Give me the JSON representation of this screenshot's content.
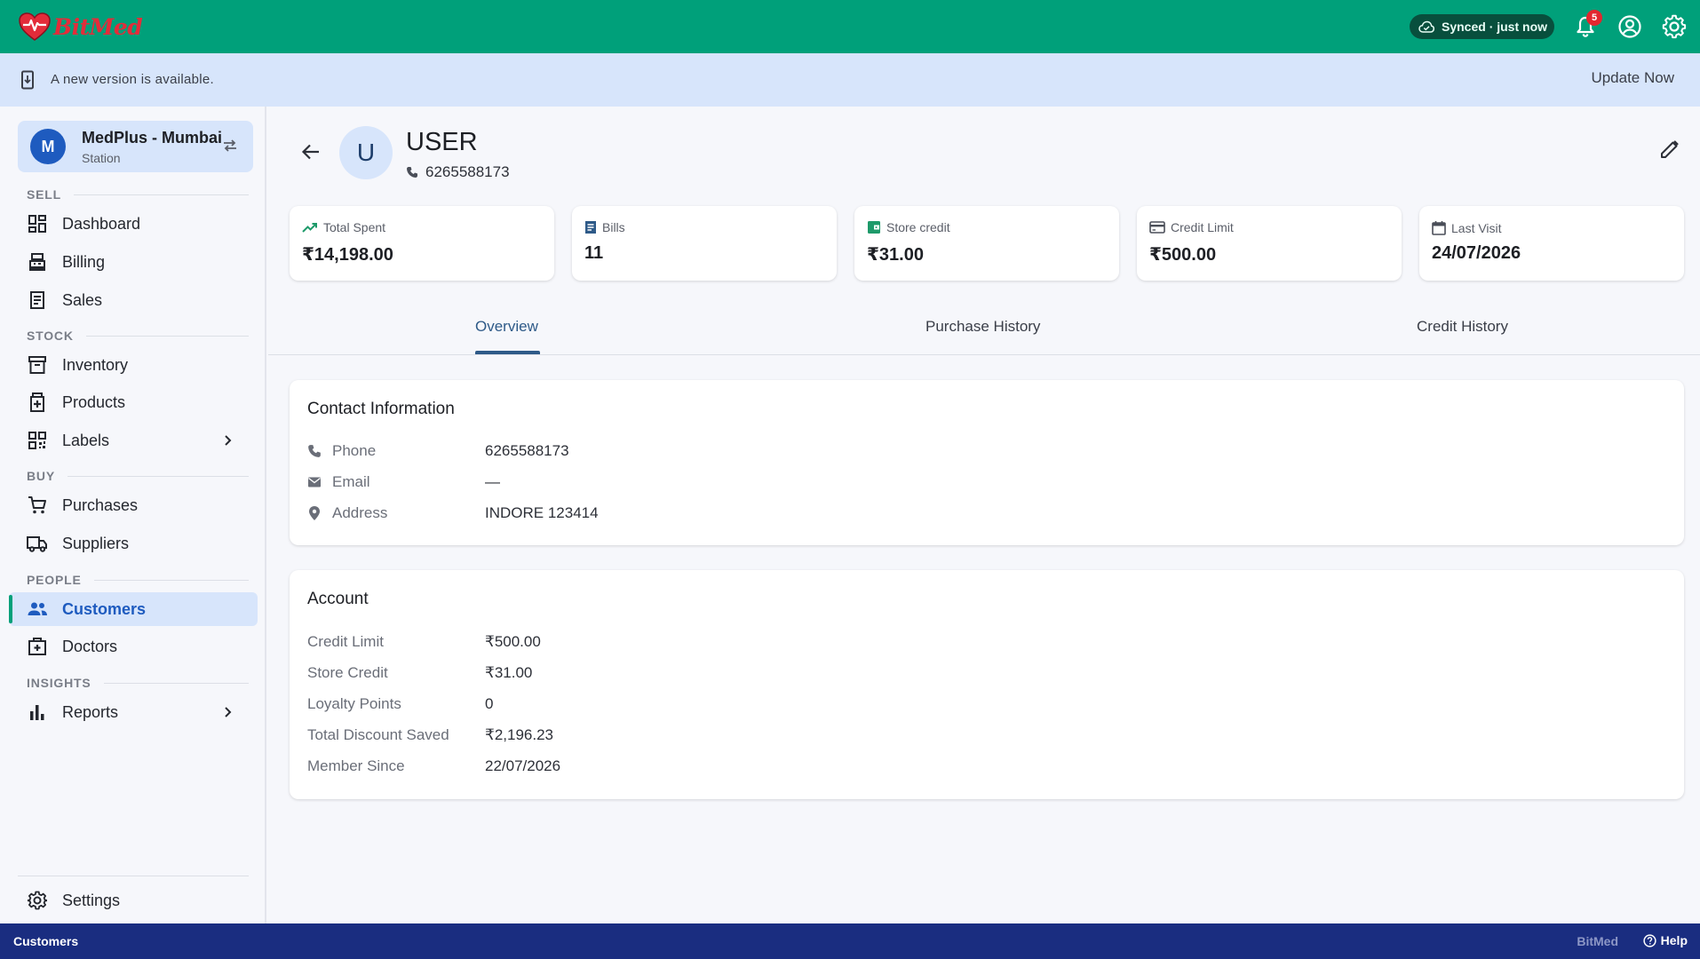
{
  "app": {
    "brand": "BitMed",
    "sync_status": "Synced · just now",
    "notification_count": "5"
  },
  "banner": {
    "message": "A new version is available.",
    "action": "Update Now"
  },
  "store": {
    "avatar_letter": "M",
    "name": "MedPlus - Mumbai",
    "type": "Station"
  },
  "sidebar": {
    "sections": {
      "sell": "SELL",
      "stock": "STOCK",
      "buy": "BUY",
      "people": "PEOPLE",
      "insights": "INSIGHTS"
    },
    "items": {
      "dashboard": "Dashboard",
      "billing": "Billing",
      "sales": "Sales",
      "inventory": "Inventory",
      "products": "Products",
      "labels": "Labels",
      "purchases": "Purchases",
      "suppliers": "Suppliers",
      "customers": "Customers",
      "doctors": "Doctors",
      "reports": "Reports",
      "settings": "Settings"
    },
    "active": "customers"
  },
  "customer": {
    "avatar_letter": "U",
    "name": "USER",
    "phone": "6265588173"
  },
  "stats": {
    "total_spent": {
      "label": "Total Spent",
      "value": "₹14,198.00"
    },
    "bills": {
      "label": "Bills",
      "value": "11"
    },
    "store_credit": {
      "label": "Store credit",
      "value": "₹31.00"
    },
    "credit_limit": {
      "label": "Credit Limit",
      "value": "₹500.00"
    },
    "last_visit": {
      "label": "Last Visit",
      "value": "24/07/2026"
    }
  },
  "tabs": {
    "overview": "Overview",
    "purchase_history": "Purchase History",
    "credit_history": "Credit History",
    "active": "overview"
  },
  "contact": {
    "title": "Contact Information",
    "phone_label": "Phone",
    "phone_value": "6265588173",
    "email_label": "Email",
    "email_value": "—",
    "address_label": "Address",
    "address_value": "INDORE 123414"
  },
  "account": {
    "title": "Account",
    "credit_limit_label": "Credit Limit",
    "credit_limit_value": "₹500.00",
    "store_credit_label": "Store Credit",
    "store_credit_value": "₹31.00",
    "loyalty_label": "Loyalty Points",
    "loyalty_value": "0",
    "discount_label": "Total Discount Saved",
    "discount_value": "₹2,196.23",
    "member_since_label": "Member Since",
    "member_since_value": "22/07/2026"
  },
  "footer": {
    "page": "Customers",
    "brand": "BitMed",
    "help": "Help"
  },
  "colors": {
    "topbar": "#00a07a",
    "banner": "#d7e5fb",
    "footer": "#1a2d80",
    "active_nav": "#1e5bbf",
    "brand_red": "#e32c3a"
  }
}
